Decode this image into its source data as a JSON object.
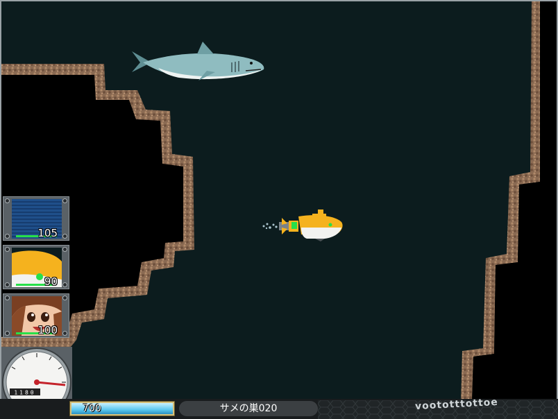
{
  "party": [
    {
      "name": "sonar",
      "hp": "105",
      "hp_fraction": 0.95
    },
    {
      "name": "submarine",
      "hp": "90",
      "hp_fraction": 0.85
    },
    {
      "name": "pilot",
      "hp": "100",
      "hp_fraction": 0.93
    }
  ],
  "gauge": {
    "odometer": "1180"
  },
  "status": {
    "air": "700",
    "air_fraction": 1.0
  },
  "location": {
    "name": "サメの巣020"
  },
  "decoration": {
    "text": "voototttottoe"
  },
  "colors": {
    "water": "#0c1c1e",
    "rock": "#8a6a52",
    "accent": "#f5b21e",
    "hp": "#27e04a"
  }
}
